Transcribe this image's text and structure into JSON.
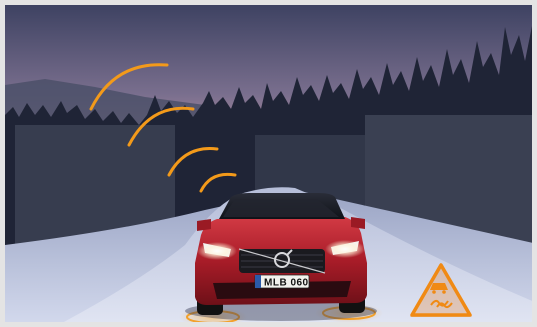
{
  "photo": {
    "license_plate": "MLB 060",
    "brand_emblem": "volvo-iron-mark",
    "warning_sign_icon": "slippery-road-icon",
    "signal_icon": "wireless-signal-arcs-icon",
    "colors": {
      "sky_top": "#4a4e6e",
      "sky_horizon": "#e9b9a8",
      "car_body": "#b4202c",
      "signal_orange": "#f39a1a",
      "snow": "#c9d2e6"
    }
  }
}
